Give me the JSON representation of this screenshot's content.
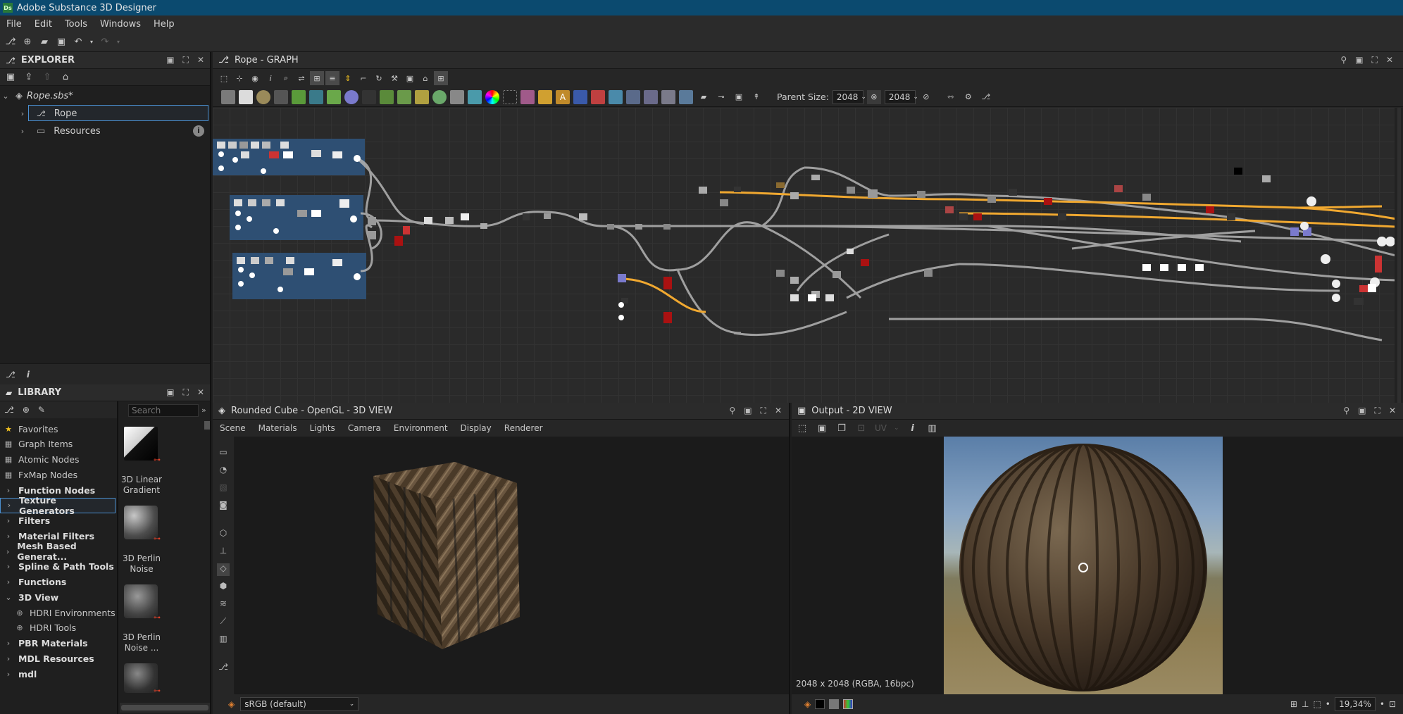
{
  "window": {
    "title": "Adobe Substance 3D Designer",
    "logo": "Ds"
  },
  "menu": [
    "File",
    "Edit",
    "Tools",
    "Windows",
    "Help"
  ],
  "explorer": {
    "title": "EXPLORER",
    "package": "Rope.sbs*",
    "graph": "Rope",
    "resources": "Resources"
  },
  "library": {
    "title": "LIBRARY",
    "search_placeholder": "Search",
    "categories": [
      {
        "label": "Favorites",
        "bold": false,
        "icon": "star"
      },
      {
        "label": "Graph Items",
        "bold": false,
        "icon": "grid"
      },
      {
        "label": "Atomic Nodes",
        "bold": false,
        "icon": "grid"
      },
      {
        "label": "FxMap Nodes",
        "bold": false,
        "icon": "grid"
      },
      {
        "label": "Function Nodes",
        "bold": true,
        "icon": "chevron"
      },
      {
        "label": "Texture Generators",
        "bold": true,
        "icon": "chevron",
        "selected": true
      },
      {
        "label": "Filters",
        "bold": true,
        "icon": "chevron"
      },
      {
        "label": "Material Filters",
        "bold": true,
        "icon": "chevron"
      },
      {
        "label": "Mesh Based Generat...",
        "bold": true,
        "icon": "chevron"
      },
      {
        "label": "Spline & Path Tools",
        "bold": true,
        "icon": "chevron"
      },
      {
        "label": "Functions",
        "bold": true,
        "icon": "chevron"
      },
      {
        "label": "3D View",
        "bold": true,
        "icon": "chevron-open"
      },
      {
        "label": "HDRI Environments",
        "bold": false,
        "icon": "globe",
        "indent": true
      },
      {
        "label": "HDRI Tools",
        "bold": false,
        "icon": "globe",
        "indent": true
      },
      {
        "label": "PBR Materials",
        "bold": true,
        "icon": "chevron"
      },
      {
        "label": "MDL Resources",
        "bold": true,
        "icon": "chevron"
      },
      {
        "label": "mdl",
        "bold": true,
        "icon": "chevron"
      }
    ],
    "thumbnails": [
      {
        "label1": "3D Linear",
        "label2": "Gradient"
      },
      {
        "label1": "3D Perlin",
        "label2": "Noise"
      },
      {
        "label1": "3D Perlin",
        "label2": "Noise ..."
      },
      {
        "label1": "",
        "label2": ""
      }
    ]
  },
  "graph": {
    "title": "Rope - GRAPH",
    "parent_size_label": "Parent Size:",
    "size_w": "2048",
    "size_h": "2048"
  },
  "view3d": {
    "title": "Rounded Cube - OpenGL - 3D VIEW",
    "menu": [
      "Scene",
      "Materials",
      "Lights",
      "Camera",
      "Environment",
      "Display",
      "Renderer"
    ],
    "colorspace": "sRGB (default)"
  },
  "view2d": {
    "title": "Output - 2D VIEW",
    "uv_label": "UV",
    "resolution": "2048 x 2048 (RGBA, 16bpc)",
    "zoom": "19,34%"
  },
  "colors": {
    "accent": "#0b4a6f",
    "frame_blue": "#2e4f73",
    "wire_orange": "#f0a830",
    "wire_gray": "#b4b4b4"
  }
}
